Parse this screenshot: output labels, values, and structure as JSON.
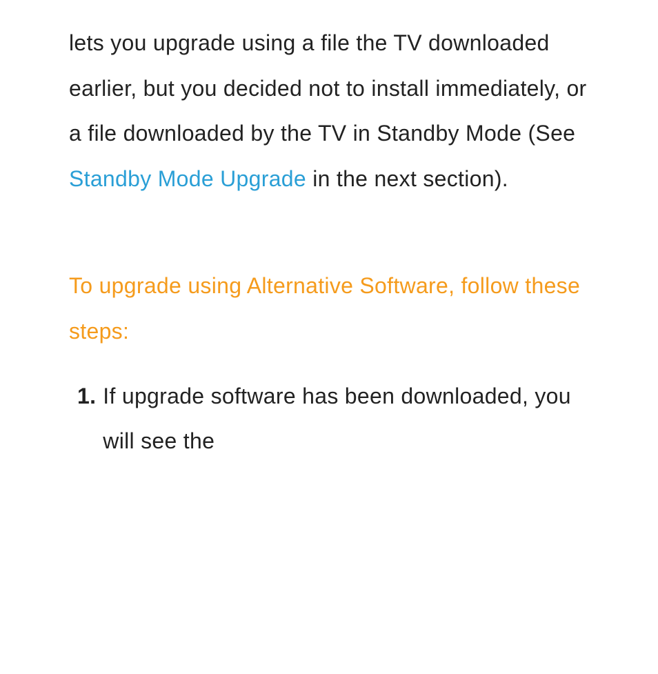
{
  "intro": {
    "part1": "lets you upgrade using a file the TV downloaded earlier, but you decided not to install immediately, or a file downloaded by the TV in Standby Mode (See ",
    "link": "Standby Mode Upgrade",
    "part2": " in the next section)."
  },
  "heading": "To upgrade using Alternative Software, follow these steps:",
  "steps": {
    "n1": "1.",
    "s1": "If upgrade software has been downloaded, you will see the"
  }
}
